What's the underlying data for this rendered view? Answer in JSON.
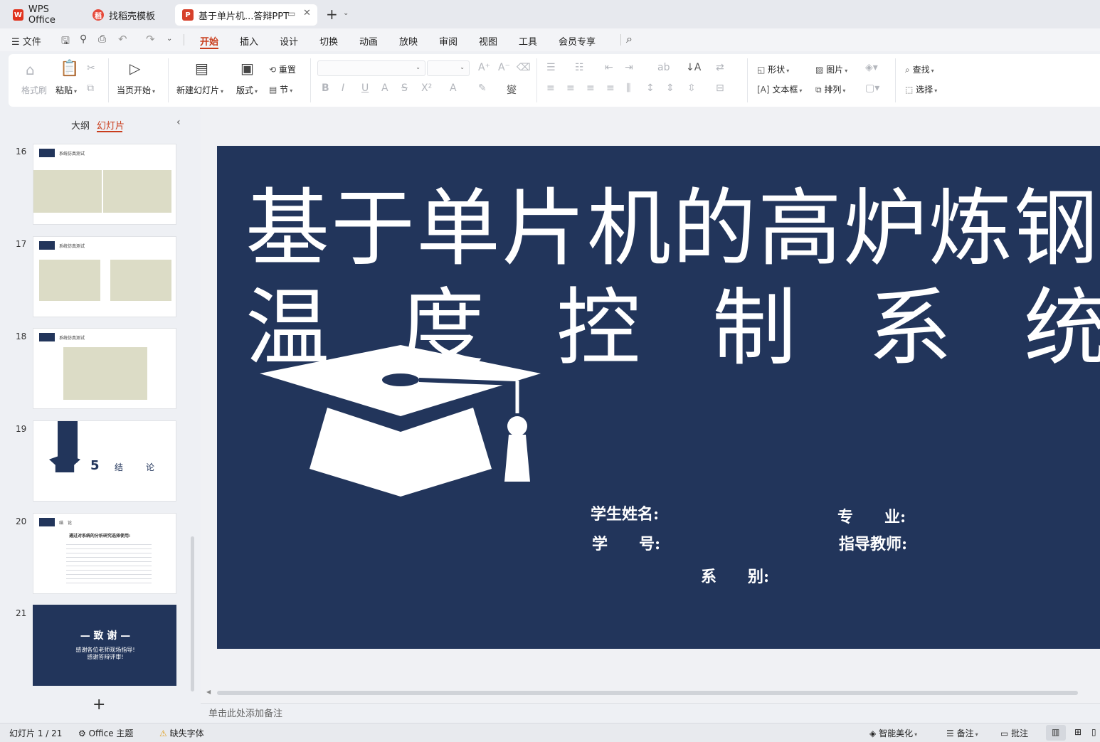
{
  "tabs": [
    {
      "label": "WPS Office",
      "icon": "wps-logo-icon"
    },
    {
      "label": "找稻壳模板",
      "icon": "docer-icon"
    },
    {
      "label": "基于单片机...答辩PPT",
      "icon": "ppt-icon"
    }
  ],
  "menu": {
    "file": "文件",
    "items": [
      "开始",
      "插入",
      "设计",
      "切换",
      "动画",
      "放映",
      "审阅",
      "视图",
      "工具",
      "会员专享"
    ]
  },
  "ribbon": {
    "format_painter": "格式刷",
    "paste": "粘贴",
    "play_from_current": "当页开始",
    "new_slide": "新建幻灯片",
    "layout": "版式",
    "reset": "重置",
    "section": "节",
    "shape": "形状",
    "picture": "图片",
    "textbox": "文本框",
    "arrange": "排列",
    "find": "查找",
    "select": "选择"
  },
  "panel": {
    "tab_outline": "大纲",
    "tab_slides": "幻灯片",
    "add": "+"
  },
  "thumbs": [
    {
      "num": "16",
      "title": "系统仿真测试"
    },
    {
      "num": "17",
      "title": "系统仿真测试"
    },
    {
      "num": "18",
      "title": "系统仿真测试"
    },
    {
      "num": "19",
      "num_big": "5",
      "label_a": "结",
      "label_b": "论"
    },
    {
      "num": "20",
      "title": "结　论",
      "body": "通过对系统的分析研究选择使用:"
    },
    {
      "num": "21",
      "line1": "— 致 谢 —",
      "line2": "感谢各位老师现场指导!",
      "line3": "感谢答辩评审!"
    }
  ],
  "slide": {
    "title_line1": "基于单片机的高炉炼钢",
    "title_line2_chars": [
      "温",
      "度",
      "控",
      "制",
      "系",
      "统"
    ],
    "student_name": "学生姓名:",
    "major": "专　　业:",
    "student_id": "学　　号:",
    "advisor": "指导教师:",
    "department": "系　　别:"
  },
  "notes_placeholder": "单击此处添加备注",
  "status": {
    "slide_count": "幻灯片 1 / 21",
    "theme": "Office 主题",
    "missing_font": "缺失字体",
    "beautify": "智能美化",
    "notes": "备注",
    "comments": "批注"
  },
  "colors": {
    "accent": "#c93d1c",
    "slide_bg": "#22355b"
  }
}
